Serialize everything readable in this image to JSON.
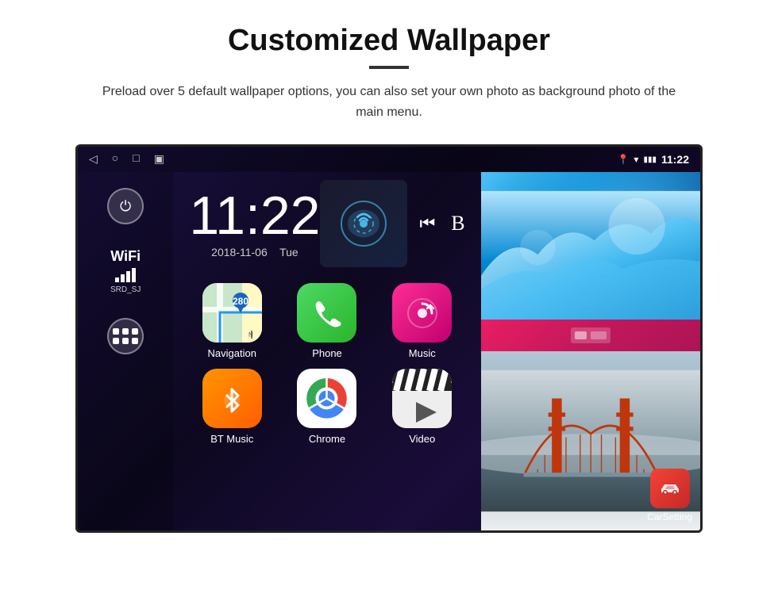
{
  "header": {
    "title": "Customized Wallpaper",
    "description": "Preload over 5 default wallpaper options, you can also set your own photo as background photo of the main menu."
  },
  "statusBar": {
    "time": "11:22",
    "navBack": "◁",
    "navHome": "○",
    "navRecent": "□",
    "navScreenshot": "▣"
  },
  "sidebar": {
    "powerLabel": "⏻",
    "wifiLabel": "WiFi",
    "wifiSsid": "SRD_SJ",
    "appsLabel": "⊞"
  },
  "clock": {
    "time": "11:22",
    "date": "2018-11-06",
    "day": "Tue"
  },
  "apps": [
    {
      "id": "navigation",
      "label": "Navigation",
      "type": "nav"
    },
    {
      "id": "phone",
      "label": "Phone",
      "type": "phone"
    },
    {
      "id": "music",
      "label": "Music",
      "type": "music"
    },
    {
      "id": "bt-music",
      "label": "BT Music",
      "type": "bt"
    },
    {
      "id": "chrome",
      "label": "Chrome",
      "type": "chrome"
    },
    {
      "id": "video",
      "label": "Video",
      "type": "video"
    }
  ],
  "wallpaperPanel": {
    "carSettingLabel": "CarSetting"
  },
  "colors": {
    "accent": "#4285f4",
    "background": "#1a1040"
  }
}
